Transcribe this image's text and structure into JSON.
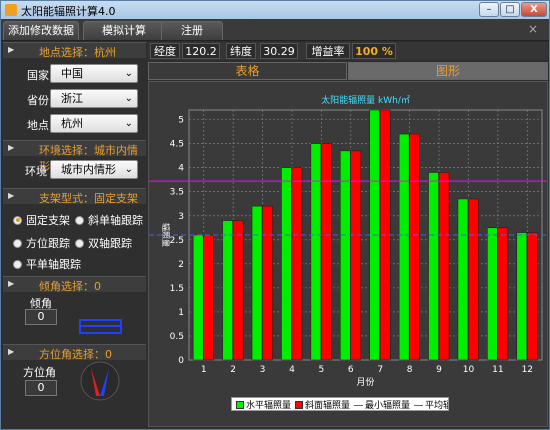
{
  "window": {
    "title": "太阳能辐照计算4.0",
    "min_label": "–",
    "max_label": "□",
    "close_label": "X"
  },
  "menubar": {
    "tabs": [
      "添加修改数据",
      "模拟计算",
      "注册"
    ],
    "close_label": "×"
  },
  "sidebar": {
    "location": {
      "header": "地点选择：杭州",
      "country_label": "国家",
      "country_value": "中国",
      "province_label": "省份",
      "province_value": "浙江",
      "place_label": "地点",
      "place_value": "杭州"
    },
    "environment": {
      "header": "环境选择：城市内情形",
      "label": "环境",
      "value": "城市内情形"
    },
    "mount": {
      "header": "支架型式：固定支架",
      "options": [
        "固定支架",
        "斜单轴跟踪",
        "方位跟踪",
        "双轴跟踪",
        "平单轴跟踪"
      ],
      "selected": "固定支架"
    },
    "tilt": {
      "header": "倾角选择：0",
      "label": "倾角",
      "value": "0"
    },
    "azimuth": {
      "header": "方位角选择：0",
      "label": "方位角",
      "value": "0"
    }
  },
  "params": {
    "longitude_label": "经度",
    "longitude_value": "120.2",
    "latitude_label": "纬度",
    "latitude_value": "30.29",
    "gain_label": "增益率",
    "gain_value": "100 %"
  },
  "view_tabs": {
    "table": "表格",
    "chart": "图形",
    "active": "chart"
  },
  "chart_data": {
    "type": "bar",
    "title": "太阳能辐照量 kWh/㎡",
    "xlabel": "月份",
    "ylabel": "辐照量",
    "categories": [
      "1",
      "2",
      "3",
      "4",
      "5",
      "6",
      "7",
      "8",
      "9",
      "10",
      "11",
      "12"
    ],
    "series": [
      {
        "name": "水平辐照量",
        "color": "#00ee00",
        "values": [
          2.6,
          2.9,
          3.2,
          4.0,
          4.5,
          4.35,
          5.2,
          4.7,
          3.9,
          3.35,
          2.75,
          2.65
        ]
      },
      {
        "name": "斜面辐照量",
        "color": "#ff0000",
        "values": [
          2.6,
          2.9,
          3.2,
          4.0,
          4.5,
          4.35,
          5.2,
          4.7,
          3.9,
          3.35,
          2.75,
          2.65
        ]
      }
    ],
    "reference_lines": [
      {
        "name": "最小辐照量",
        "color": "#4060ff",
        "value": 2.6
      },
      {
        "name": "平均辐照量",
        "color": "#ff00ff",
        "value": 3.72
      }
    ],
    "yticks": [
      "0",
      "0.5",
      "1",
      "1.5",
      "2",
      "2.5",
      "3",
      "3.5",
      "4",
      "4.5",
      "5"
    ],
    "ylim": [
      0,
      5.2
    ],
    "grid": true,
    "legend": "bottom"
  }
}
